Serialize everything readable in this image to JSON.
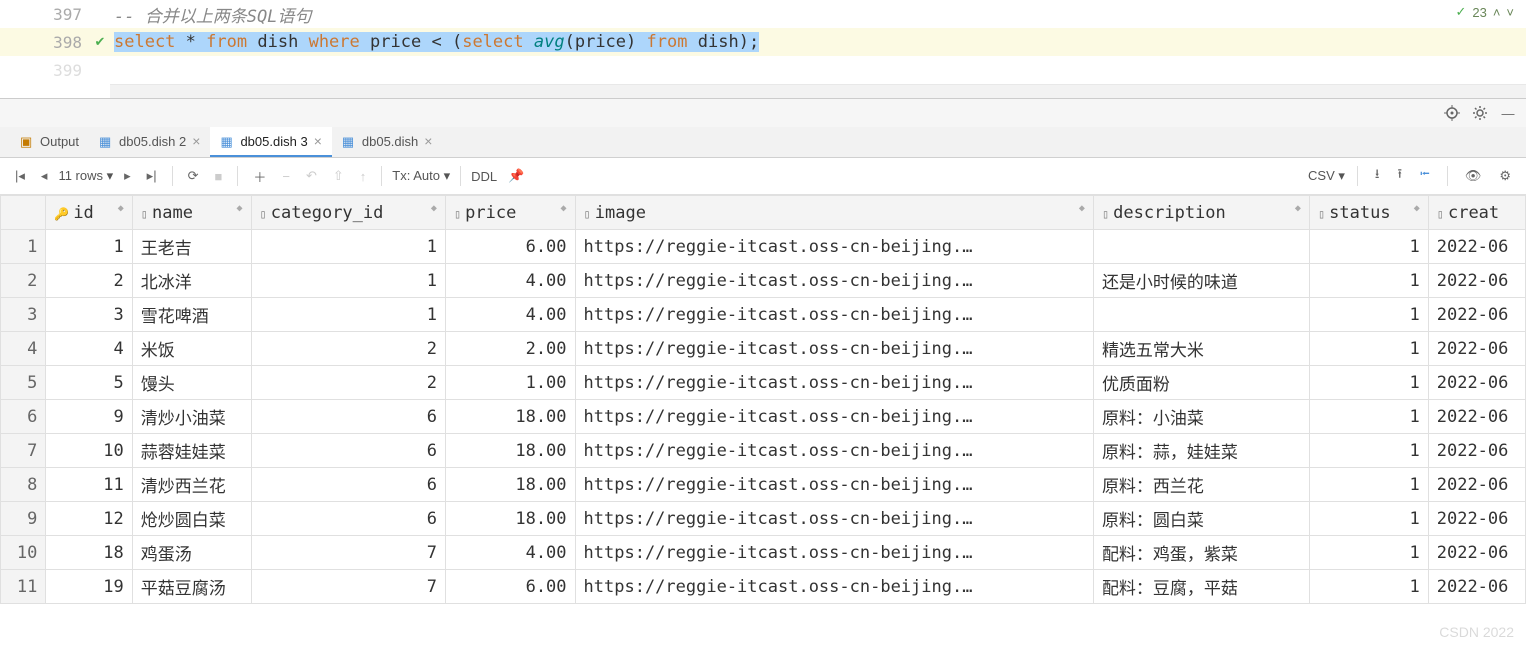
{
  "editor": {
    "lines": [
      {
        "num": "397",
        "type": "comment",
        "text": "-- 合并以上两条SQL语句"
      },
      {
        "num": "398",
        "type": "sql",
        "status": "ok"
      }
    ],
    "sql": {
      "select": "select",
      "star": "*",
      "from1": "from",
      "dish1": "dish",
      "where": "where",
      "price1": "price",
      "lt": "<",
      "lp": "(",
      "select2": "select",
      "avg": "avg",
      "lp2": "(",
      "price2": "price",
      "rp2": ")",
      "from2": "from",
      "dish2": "dish",
      "rp": ")",
      "semi": ";"
    },
    "hint": {
      "icon": "✓",
      "count": "23"
    }
  },
  "tabs": [
    {
      "icon": "output",
      "label": "Output",
      "closable": false
    },
    {
      "icon": "grid",
      "label": "db05.dish 2",
      "closable": true
    },
    {
      "icon": "grid",
      "label": "db05.dish 3",
      "closable": true,
      "active": true
    },
    {
      "icon": "grid",
      "label": "db05.dish",
      "closable": true
    }
  ],
  "toolbar": {
    "rows": "11 rows",
    "tx": "Tx: Auto",
    "ddl": "DDL",
    "export": "CSV"
  },
  "columns": [
    "id",
    "name",
    "category_id",
    "price",
    "image",
    "description",
    "status",
    "creat"
  ],
  "rows": [
    {
      "n": "1",
      "id": "1",
      "name": "王老吉",
      "category_id": "1",
      "price": "6.00",
      "image": "https://reggie-itcast.oss-cn-beijing.…",
      "description": "",
      "status": "1",
      "create": "2022-06"
    },
    {
      "n": "2",
      "id": "2",
      "name": "北冰洋",
      "category_id": "1",
      "price": "4.00",
      "image": "https://reggie-itcast.oss-cn-beijing.…",
      "description": "还是小时候的味道",
      "status": "1",
      "create": "2022-06"
    },
    {
      "n": "3",
      "id": "3",
      "name": "雪花啤酒",
      "category_id": "1",
      "price": "4.00",
      "image": "https://reggie-itcast.oss-cn-beijing.…",
      "description": "",
      "status": "1",
      "create": "2022-06"
    },
    {
      "n": "4",
      "id": "4",
      "name": "米饭",
      "category_id": "2",
      "price": "2.00",
      "image": "https://reggie-itcast.oss-cn-beijing.…",
      "description": "精选五常大米",
      "status": "1",
      "create": "2022-06"
    },
    {
      "n": "5",
      "id": "5",
      "name": "馒头",
      "category_id": "2",
      "price": "1.00",
      "image": "https://reggie-itcast.oss-cn-beijing.…",
      "description": "优质面粉",
      "status": "1",
      "create": "2022-06"
    },
    {
      "n": "6",
      "id": "9",
      "name": "清炒小油菜",
      "category_id": "6",
      "price": "18.00",
      "image": "https://reggie-itcast.oss-cn-beijing.…",
      "description": "原料：小油菜",
      "status": "1",
      "create": "2022-06"
    },
    {
      "n": "7",
      "id": "10",
      "name": "蒜蓉娃娃菜",
      "category_id": "6",
      "price": "18.00",
      "image": "https://reggie-itcast.oss-cn-beijing.…",
      "description": "原料：蒜，娃娃菜",
      "status": "1",
      "create": "2022-06"
    },
    {
      "n": "8",
      "id": "11",
      "name": "清炒西兰花",
      "category_id": "6",
      "price": "18.00",
      "image": "https://reggie-itcast.oss-cn-beijing.…",
      "description": "原料：西兰花",
      "status": "1",
      "create": "2022-06"
    },
    {
      "n": "9",
      "id": "12",
      "name": "炝炒圆白菜",
      "category_id": "6",
      "price": "18.00",
      "image": "https://reggie-itcast.oss-cn-beijing.…",
      "description": "原料：圆白菜",
      "status": "1",
      "create": "2022-06"
    },
    {
      "n": "10",
      "id": "18",
      "name": "鸡蛋汤",
      "category_id": "7",
      "price": "4.00",
      "image": "https://reggie-itcast.oss-cn-beijing.…",
      "description": "配料：鸡蛋，紫菜",
      "status": "1",
      "create": "2022-06"
    },
    {
      "n": "11",
      "id": "19",
      "name": "平菇豆腐汤",
      "category_id": "7",
      "price": "6.00",
      "image": "https://reggie-itcast.oss-cn-beijing.…",
      "description": "配料：豆腐，平菇",
      "status": "1",
      "create": "2022-06"
    }
  ],
  "watermark": "CSDN 2022"
}
